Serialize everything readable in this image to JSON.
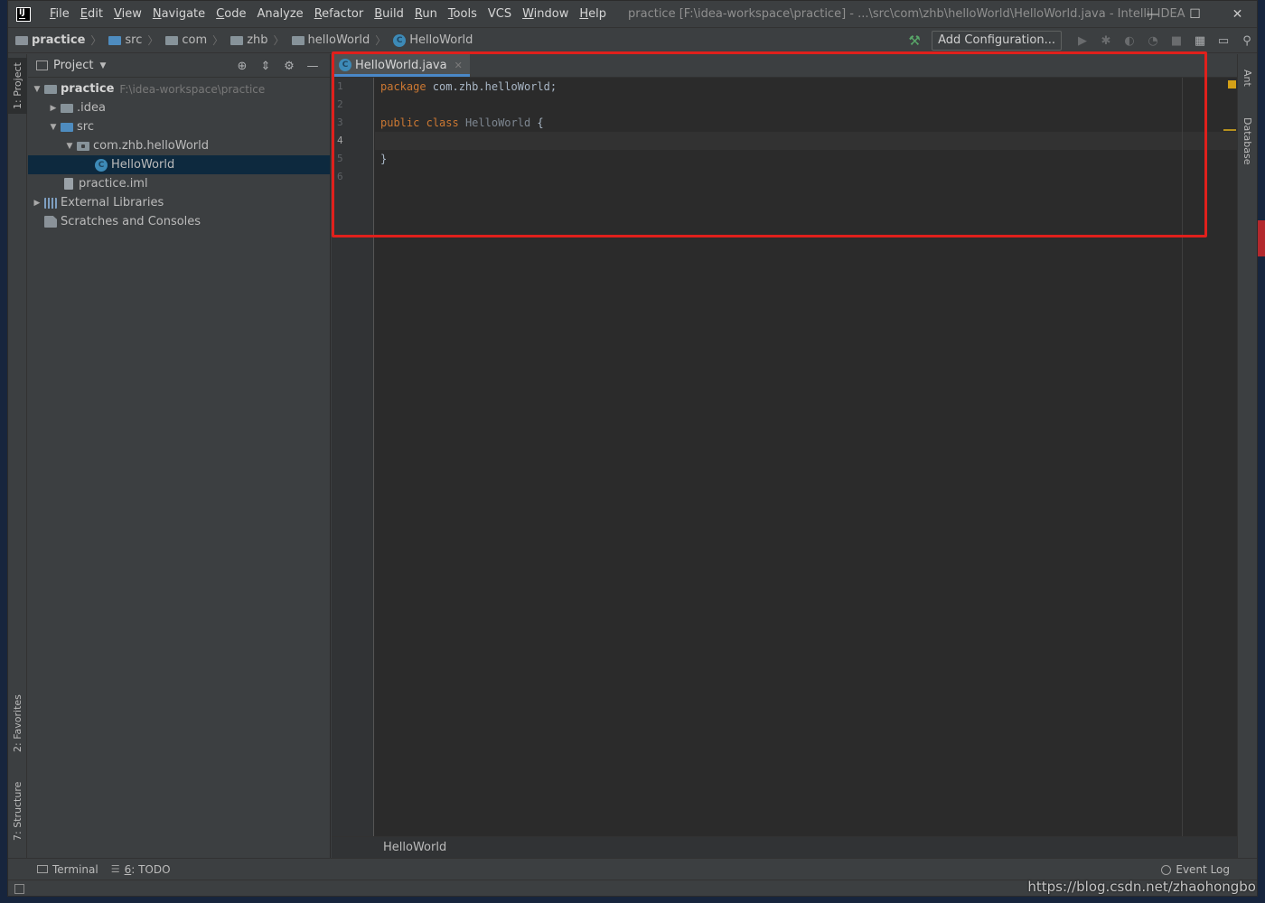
{
  "titlebar": {
    "menu": [
      {
        "label": "File",
        "mnemonic": "F",
        "rest": "ile"
      },
      {
        "label": "Edit",
        "mnemonic": "E",
        "rest": "dit"
      },
      {
        "label": "View",
        "mnemonic": "V",
        "rest": "iew"
      },
      {
        "label": "Navigate",
        "mnemonic": "N",
        "rest": "avigate"
      },
      {
        "label": "Code",
        "mnemonic": "C",
        "rest": "ode"
      },
      {
        "label": "Analyze",
        "mnemonic": "",
        "rest": "Analyze"
      },
      {
        "label": "Refactor",
        "mnemonic": "R",
        "rest": "efactor"
      },
      {
        "label": "Build",
        "mnemonic": "B",
        "rest": "uild"
      },
      {
        "label": "Run",
        "mnemonic": "R",
        "rest": "un"
      },
      {
        "label": "Tools",
        "mnemonic": "T",
        "rest": "ools"
      },
      {
        "label": "VCS",
        "mnemonic": "",
        "rest": "VCS"
      },
      {
        "label": "Window",
        "mnemonic": "W",
        "rest": "indow"
      },
      {
        "label": "Help",
        "mnemonic": "H",
        "rest": "elp"
      }
    ],
    "window_title": "practice [F:\\idea-workspace\\practice] - ...\\src\\com\\zhb\\helloWorld\\HelloWorld.java - IntelliJ IDEA",
    "controls": {
      "minimize": "—",
      "maximize": "☐",
      "close": "✕"
    }
  },
  "navbar": {
    "crumbs": [
      "practice",
      "src",
      "com",
      "zhb",
      "helloWorld",
      "HelloWorld"
    ],
    "add_configuration": "Add Configuration..."
  },
  "left_stripe": {
    "project_tab": "1: Project",
    "favorites_tab": "2: Favorites",
    "structure_tab": "7: Structure"
  },
  "right_stripe": {
    "ant_tab": "Ant",
    "database_tab": "Database"
  },
  "project_panel": {
    "title": "Project",
    "tree": [
      {
        "label": "practice",
        "path": "F:\\idea-workspace\\practice"
      },
      {
        "label": ".idea"
      },
      {
        "label": "src"
      },
      {
        "label": "com.zhb.helloWorld"
      },
      {
        "label": "HelloWorld"
      },
      {
        "label": "practice.iml"
      },
      {
        "label": "External Libraries"
      },
      {
        "label": "Scratches and Consoles"
      }
    ]
  },
  "editor": {
    "tab_label": "HelloWorld.java",
    "line_numbers": [
      "1",
      "2",
      "3",
      "4",
      "5",
      "6"
    ],
    "current_line": 4,
    "code": {
      "line1_kw": "package",
      "line1_rest": " com.zhb.helloWorld;",
      "line3_kw1": "public",
      "line3_kw2": "class",
      "line3_name": "HelloWorld",
      "line3_brace": " {",
      "line5": "}"
    },
    "breadcrumb": "HelloWorld"
  },
  "bottom_tools": {
    "terminal": "Terminal",
    "todo_num": "6",
    "todo": ": TODO",
    "event_log": "Event Log"
  },
  "watermark": "https://blog.csdn.net/zhaohongbo",
  "colors": {
    "keyword": "#cc7832",
    "selection": "#0d293e",
    "highlight_box": "#e0201c",
    "tab_underline": "#4a88c7"
  }
}
